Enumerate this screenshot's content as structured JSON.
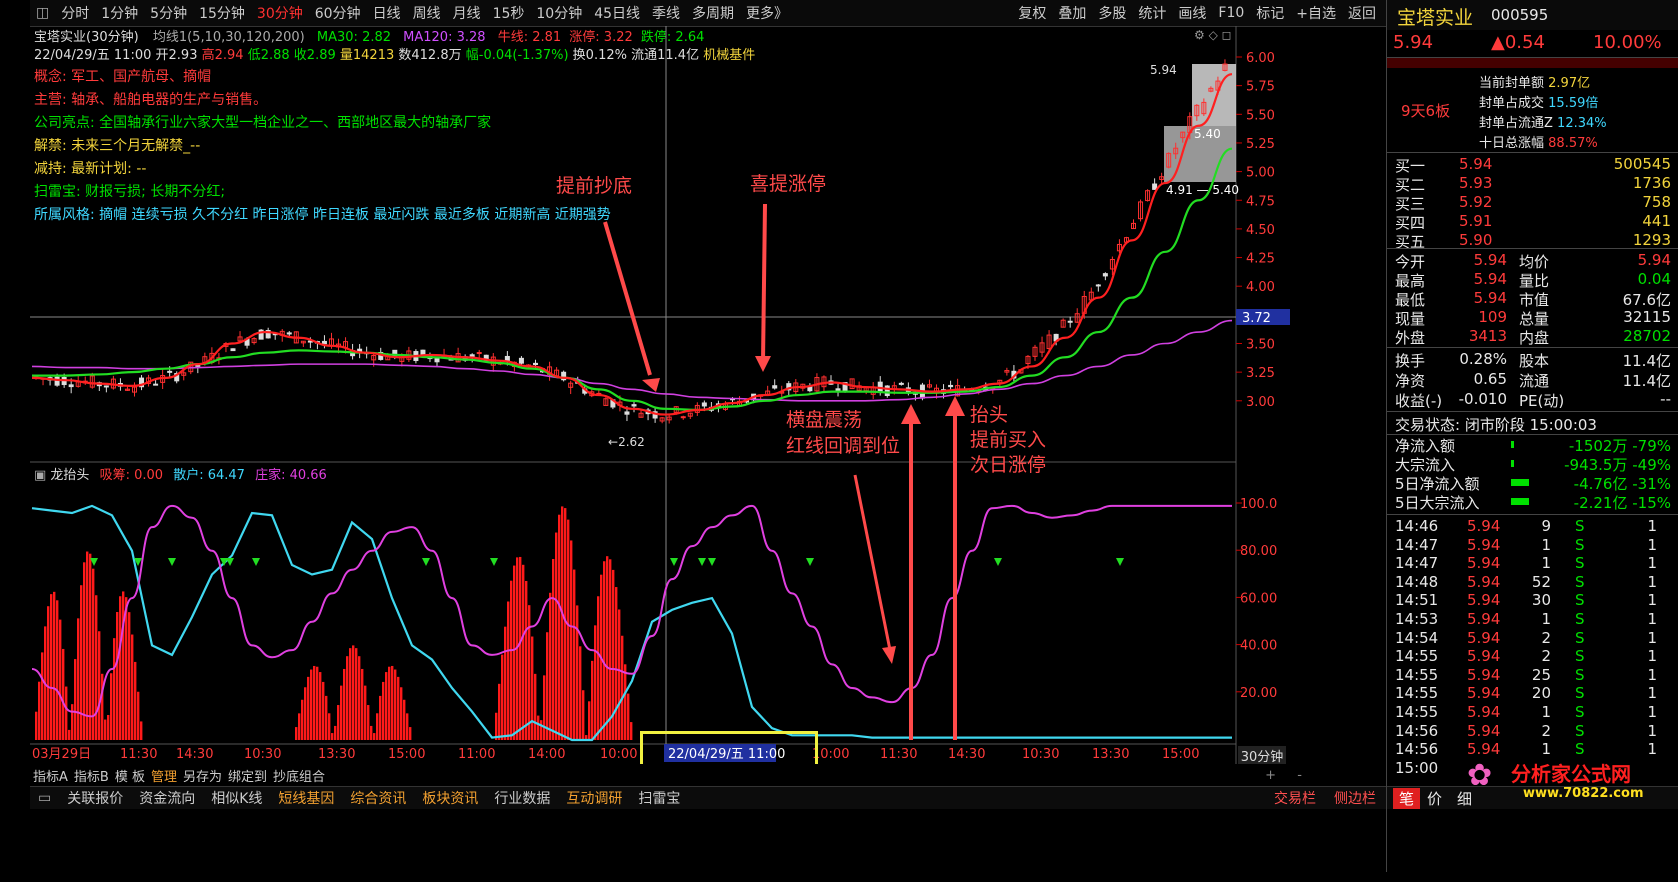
{
  "toolbar": {
    "periods": [
      "分时",
      "1分钟",
      "5分钟",
      "15分钟",
      "30分钟",
      "60分钟",
      "日线",
      "周线",
      "月线",
      "15秒",
      "10分钟",
      "45日线",
      "季线",
      "多周期",
      "更多》"
    ],
    "active_period": "30分钟",
    "right_items": [
      "复权",
      "叠加",
      "多股",
      "统计",
      "画线",
      "F10",
      "标记",
      "+自选",
      "返回"
    ]
  },
  "header": {
    "stock_label": "宝塔实业(30分钟)",
    "ma_label": "均线1(5,10,30,120,200)",
    "ma30": "MA30: 2.82",
    "ma120": "MA120: 3.28",
    "niuxian": "牛线: 2.81",
    "zhangting": "涨停: 3.22",
    "dieting": "跌停: 2.64",
    "bar_info": {
      "date": "22/04/29/五 11:00",
      "open": "开2.93",
      "high": "高2.94",
      "low": "低2.88",
      "close": "收2.89",
      "vol": "量14213",
      "amount": "数412.8万",
      "change": "幅-0.04(-1.37%)",
      "turnover": "换0.12%",
      "float": "流通11.4亿",
      "industry": "机械基件"
    }
  },
  "info_lines": [
    {
      "label": "概念: ",
      "text": "军工、国产航母、摘帽",
      "color": "#ff3b3b"
    },
    {
      "label": "主营: ",
      "text": "轴承、船舶电器的生产与销售。",
      "color": "#ff3b3b"
    },
    {
      "label": "公司亮点: ",
      "text": "全国轴承行业六家大型一档企业之一、西部地区最大的轴承厂家",
      "color": "#00e000"
    },
    {
      "label": "解禁: ",
      "text": "未来三个月无解禁_--",
      "color": "#f2d43c"
    },
    {
      "label": "减持: ",
      "text": "最新计划: --",
      "color": "#f2d43c"
    },
    {
      "label": "扫雷宝: ",
      "text": "财报亏损; 长期不分红;",
      "color": "#00e000"
    },
    {
      "label": "所属风格: ",
      "text": "摘帽 连续亏损 久不分红 昨日涨停 昨日连板 最近闪跌 最近多板 近期新高 近期强势",
      "color": "#3fd8ff"
    }
  ],
  "annotations": {
    "a1": "提前抄底",
    "a2": "喜提涨停",
    "a3_line1": "横盘震荡",
    "a3_line2": "红线回调到位",
    "a4_line1": "抬头",
    "a4_line2": "提前买入",
    "a4_line3": "次日涨停"
  },
  "price_labels": {
    "low_mark": "2.62",
    "top_mark": "5.94",
    "box_hi": "5.40",
    "box_lo": "4.91 — 5.40",
    "crosshair_price": "3.72"
  },
  "y_axis_main": [
    "6.00",
    "5.75",
    "5.50",
    "5.25",
    "5.00",
    "4.75",
    "4.50",
    "4.25",
    "4.00",
    "3.75",
    "3.50",
    "3.25",
    "3.00"
  ],
  "indicator": {
    "name": "龙抬头",
    "xi_chou": "吸筹: 0.00",
    "san_hu": "散户: 64.47",
    "zhuang_jia": "庄家: 40.66",
    "y_axis": [
      "100.0",
      "80.00",
      "60.00",
      "40.00",
      "20.00"
    ]
  },
  "x_axis": [
    "03月29日",
    "11:30",
    "14:30",
    "10:30",
    "13:30",
    "15:00",
    "11:00",
    "14:00",
    "10:00",
    "",
    "10:00",
    "11:30",
    "14:30",
    "10:30",
    "13:30",
    "15:00"
  ],
  "x_highlight": "22/04/29/五 11:00",
  "period_label": "30分钟",
  "indicator_tabs": [
    "指标A",
    "指标B",
    "模 板",
    "管理",
    "另存为",
    "绑定到",
    "抄底组合"
  ],
  "bottom_tabs": [
    "关联报价",
    "资金流向",
    "相似K线",
    "短线基因",
    "综合资讯",
    "板块资讯",
    "行业数据",
    "互动调研",
    "扫雷宝"
  ],
  "bottom_tabs_colors": [
    "#ccc",
    "#ccc",
    "#ccc",
    "#f2a030",
    "#f2a030",
    "#f2a030",
    "#ccc",
    "#f2a030",
    "#ccc"
  ],
  "bottom_right": [
    "交易栏",
    "侧边栏"
  ],
  "chart_data": {
    "type": "line",
    "title": "宝塔实业(30分钟)",
    "ylim": [
      2.6,
      6.05
    ],
    "series": [
      {
        "name": "MA30",
        "values": [
          3.2,
          3.18,
          3.15,
          3.13,
          3.2,
          3.32,
          3.5,
          3.6,
          3.55,
          3.48,
          3.42,
          3.38,
          3.4,
          3.38,
          3.35,
          3.3,
          3.2,
          3.05,
          2.93,
          2.88,
          2.92,
          2.98,
          3.05,
          3.12,
          3.16,
          3.12,
          3.1,
          3.08,
          3.1,
          3.15,
          3.3,
          3.55,
          3.9,
          4.4,
          4.9,
          5.4,
          5.85
        ]
      },
      {
        "name": "MA120",
        "values": [
          3.22,
          3.22,
          3.23,
          3.25,
          3.28,
          3.32,
          3.38,
          3.42,
          3.44,
          3.43,
          3.42,
          3.4,
          3.38,
          3.36,
          3.33,
          3.28,
          3.2,
          3.1,
          3.0,
          2.93,
          2.92,
          2.95,
          3.0,
          3.05,
          3.08,
          3.08,
          3.07,
          3.07,
          3.08,
          3.12,
          3.22,
          3.38,
          3.6,
          3.9,
          4.3,
          4.75,
          5.2
        ]
      },
      {
        "name": "MA200",
        "values": [
          3.3,
          3.29,
          3.29,
          3.28,
          3.28,
          3.29,
          3.3,
          3.31,
          3.32,
          3.32,
          3.32,
          3.31,
          3.3,
          3.28,
          3.26,
          3.23,
          3.2,
          3.15,
          3.1,
          3.06,
          3.03,
          3.02,
          3.01,
          3.0,
          3.0,
          3.0,
          3.01,
          3.03,
          3.06,
          3.1,
          3.15,
          3.22,
          3.3,
          3.4,
          3.5,
          3.6,
          3.7
        ]
      }
    ],
    "ind_series": [
      {
        "name": "散户",
        "values": [
          98,
          97,
          96,
          99,
          95,
          80,
          40,
          36,
          52,
          70,
          78,
          96,
          95,
          74,
          70,
          72,
          92,
          85,
          60,
          40,
          34,
          22,
          12,
          1,
          2,
          8,
          4,
          0,
          0,
          10,
          25,
          50,
          55,
          58,
          60,
          45,
          14,
          5,
          2,
          2,
          2,
          2,
          1,
          1,
          1,
          1,
          1,
          1,
          1,
          1,
          1,
          1,
          1,
          1,
          1,
          1,
          1,
          1,
          1,
          1,
          1
        ]
      },
      {
        "name": "庄家",
        "values": [
          30,
          22,
          12,
          10,
          30,
          60,
          90,
          99,
          94,
          80,
          60,
          40,
          35,
          38,
          50,
          62,
          72,
          80,
          88,
          90,
          80,
          60,
          40,
          36,
          38,
          48,
          60,
          48,
          38,
          30,
          28,
          44,
          68,
          82,
          90,
          95,
          99,
          80,
          62,
          48,
          32,
          22,
          18,
          16,
          22,
          36,
          60,
          80,
          98,
          99,
          96,
          94,
          95,
          97,
          99,
          99,
          99,
          99,
          99,
          99,
          99
        ]
      }
    ]
  },
  "right_panel": {
    "name": "宝塔实业",
    "code": "000595",
    "price": "5.94",
    "change": "▲0.54",
    "change_pct": "10.00%",
    "streak": "9天6板",
    "seal_info": [
      {
        "k": "当前封单额",
        "v": "2.97亿"
      },
      {
        "k": "封单占成交",
        "v": "15.59倍"
      },
      {
        "k": "封单占流通Z",
        "v": "12.34%"
      },
      {
        "k": "十日总涨幅",
        "v": "88.57%"
      }
    ],
    "bids": [
      {
        "k": "买一",
        "p": "5.94",
        "v": "500545"
      },
      {
        "k": "买二",
        "p": "5.93",
        "v": "1736"
      },
      {
        "k": "买三",
        "p": "5.92",
        "v": "758"
      },
      {
        "k": "买四",
        "p": "5.91",
        "v": "441"
      },
      {
        "k": "买五",
        "p": "5.90",
        "v": "1293"
      }
    ],
    "quote": [
      {
        "k1": "今开",
        "v1": "5.94",
        "k2": "均价",
        "v2": "5.94",
        "c1": "#ff3b3b",
        "c2": "#ff3b3b"
      },
      {
        "k1": "最高",
        "v1": "5.94",
        "k2": "量比",
        "v2": "0.04",
        "c1": "#ff3b3b",
        "c2": "#00e000"
      },
      {
        "k1": "最低",
        "v1": "5.94",
        "k2": "市值",
        "v2": "67.6亿",
        "c1": "#ff3b3b",
        "c2": "#e8e8e8"
      },
      {
        "k1": "现量",
        "v1": "109",
        "k2": "总量",
        "v2": "32115",
        "c1": "#ff3b3b",
        "c2": "#e8e8e8"
      },
      {
        "k1": "外盘",
        "v1": "3413",
        "k2": "内盘",
        "v2": "28702",
        "c1": "#ff3b3b",
        "c2": "#00e000"
      }
    ],
    "quote2": [
      {
        "k1": "换手",
        "v1": "0.28%",
        "k2": "股本",
        "v2": "11.4亿"
      },
      {
        "k1": "净资",
        "v1": "0.65",
        "k2": "流通",
        "v2": "11.4亿"
      },
      {
        "k1": "收益(-)",
        "v1": "-0.010",
        "k2": "PE(动)",
        "v2": "--"
      }
    ],
    "trade_status": "交易状态: 闭市阶段 15:00:03",
    "flows": [
      {
        "k": "净流入额",
        "v": "-1502万 -79%"
      },
      {
        "k": "大宗流入",
        "v": "-943.5万 -49%"
      },
      {
        "k": "5日净流入额",
        "v": "-4.76亿 -31%"
      },
      {
        "k": "5日大宗流入",
        "v": "-2.21亿 -15%"
      }
    ],
    "ticks": [
      {
        "t": "14:46",
        "p": "5.94",
        "v": "9",
        "s": "S",
        "n": "1"
      },
      {
        "t": "14:47",
        "p": "5.94",
        "v": "1",
        "s": "S",
        "n": "1"
      },
      {
        "t": "14:47",
        "p": "5.94",
        "v": "1",
        "s": "S",
        "n": "1"
      },
      {
        "t": "14:48",
        "p": "5.94",
        "v": "52",
        "s": "S",
        "n": "1"
      },
      {
        "t": "14:51",
        "p": "5.94",
        "v": "30",
        "s": "S",
        "n": "1"
      },
      {
        "t": "14:53",
        "p": "5.94",
        "v": "1",
        "s": "S",
        "n": "1"
      },
      {
        "t": "14:54",
        "p": "5.94",
        "v": "2",
        "s": "S",
        "n": "1"
      },
      {
        "t": "14:55",
        "p": "5.94",
        "v": "2",
        "s": "S",
        "n": "1"
      },
      {
        "t": "14:55",
        "p": "5.94",
        "v": "25",
        "s": "S",
        "n": "1"
      },
      {
        "t": "14:55",
        "p": "5.94",
        "v": "20",
        "s": "S",
        "n": "1"
      },
      {
        "t": "14:55",
        "p": "5.94",
        "v": "1",
        "s": "S",
        "n": "1"
      },
      {
        "t": "14:56",
        "p": "5.94",
        "v": "2",
        "s": "S",
        "n": "1"
      },
      {
        "t": "14:56",
        "p": "5.94",
        "v": "1",
        "s": "S",
        "n": "1"
      },
      {
        "t": "15:00",
        "p": "",
        "v": "",
        "s": "",
        "n": ""
      }
    ],
    "bottom_tabs": [
      "笔",
      "价",
      "细"
    ],
    "logo_text": "分析家公式网",
    "logo_url": "www.70822.com"
  }
}
